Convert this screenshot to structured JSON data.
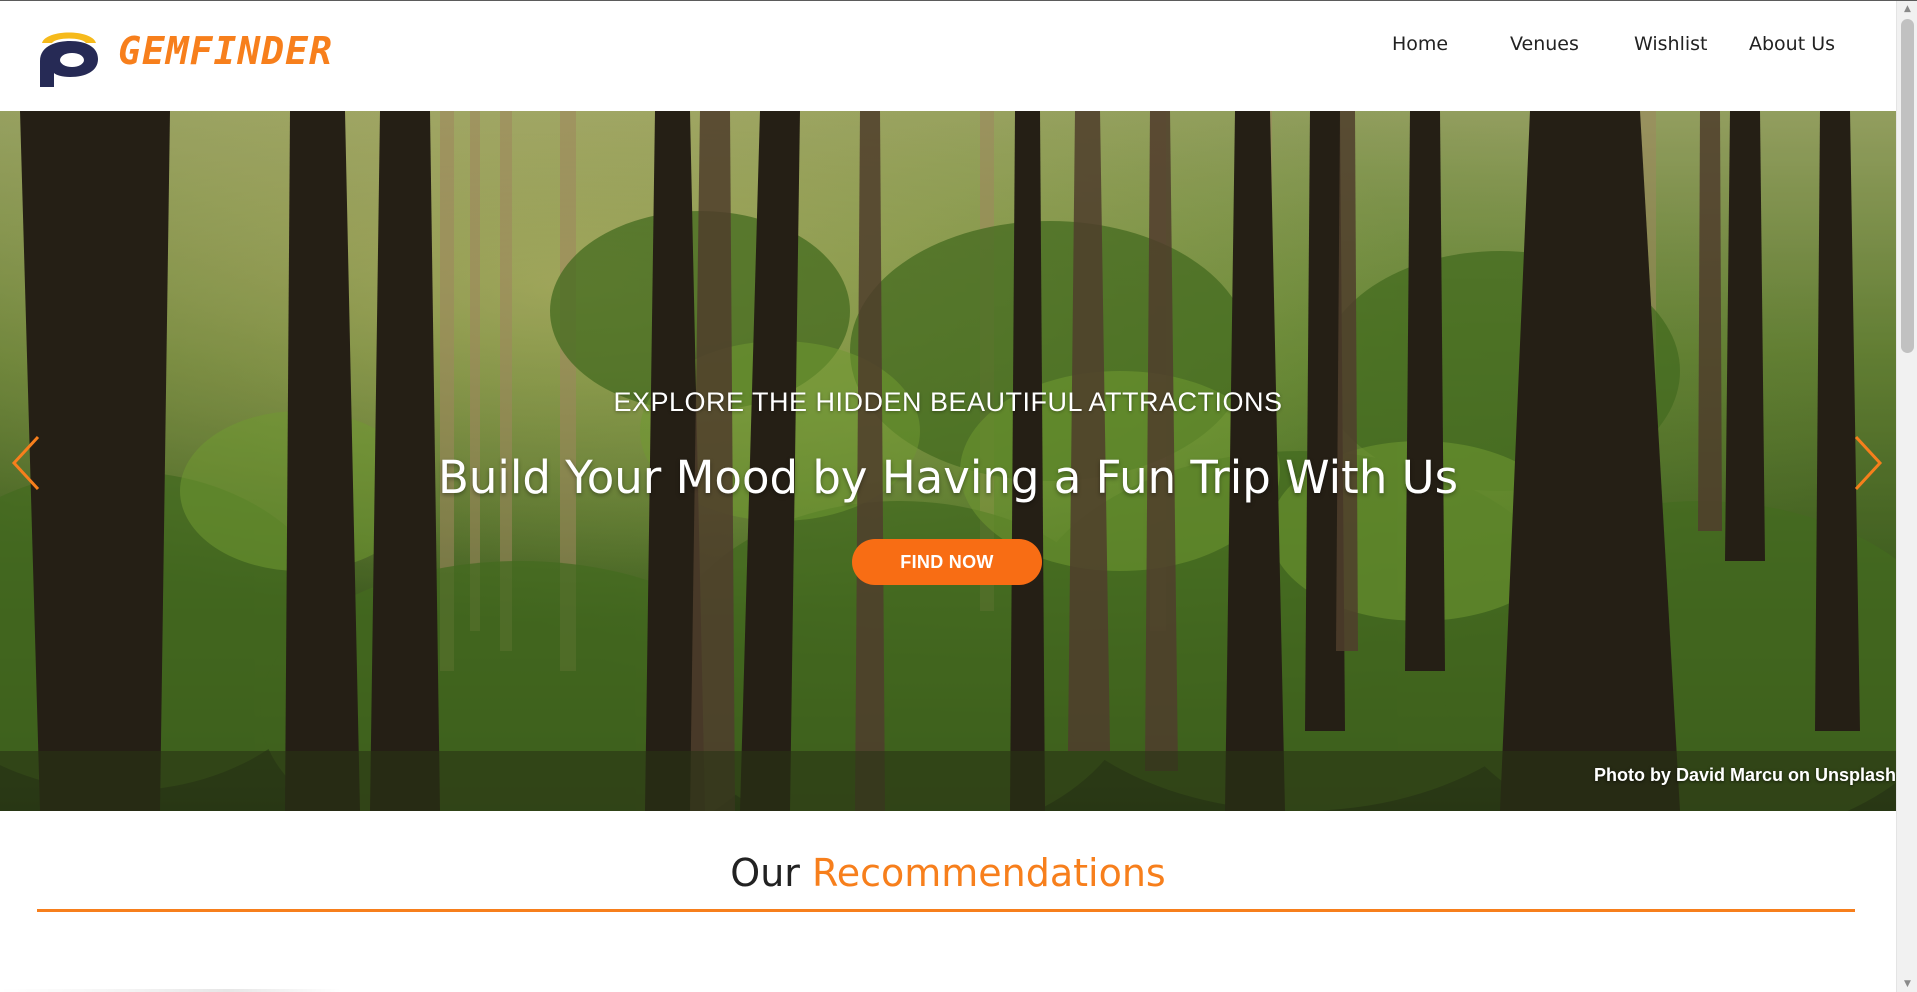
{
  "brand": {
    "name": "GEMFINDER",
    "accent_color": "#f77f1c",
    "logo_icon": "gemfinder-logo-icon",
    "logo_colors": [
      "#f6ba1b",
      "#262a55"
    ]
  },
  "nav": {
    "items": [
      {
        "label": "Home"
      },
      {
        "label": "Venues"
      },
      {
        "label": "Wishlist"
      },
      {
        "label": "About Us"
      }
    ]
  },
  "hero": {
    "kicker": "EXPLORE THE HIDDEN BEAUTIFUL ATTRACTIONS",
    "title": "Build Your Mood by Having a Fun Trip With Us",
    "cta_label": "FIND NOW",
    "cta_color": "#f86d14",
    "photo_credit": "Photo by David Marcu on Unsplash",
    "prev_icon": "chevron-left-icon",
    "next_icon": "chevron-right-icon",
    "arrow_color": "#f77f1c"
  },
  "recommendations": {
    "heading_plain": "Our",
    "heading_accent": "Recommendations"
  }
}
